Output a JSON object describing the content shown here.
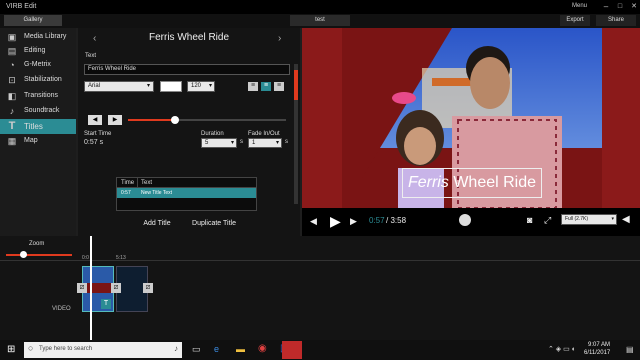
{
  "window": {
    "title": "VIRB Edit",
    "menu": "Menu",
    "min": "–",
    "max": "□",
    "close": "✕"
  },
  "toolbar": {
    "gallery": "Gallery",
    "project_tab": "test",
    "export": "Export",
    "share": "Share"
  },
  "sidebar": {
    "items": [
      {
        "label": "Media Library",
        "icon": "media-icon"
      },
      {
        "label": "Editing",
        "icon": "editing-icon"
      },
      {
        "label": "G-Metrix",
        "icon": "gmetrix-icon"
      },
      {
        "label": "Stabilization",
        "icon": "stabilization-icon"
      },
      {
        "label": "Transitions",
        "icon": "transitions-icon"
      },
      {
        "label": "Soundtrack",
        "icon": "soundtrack-icon"
      },
      {
        "label": "Titles",
        "icon": "titles-icon"
      },
      {
        "label": "Map",
        "icon": "map-icon"
      }
    ]
  },
  "panel": {
    "title": "Ferris Wheel Ride",
    "text_label": "Text",
    "text_value": "Ferris Wheel Ride",
    "font": "Arial",
    "font_size": "120",
    "start_time_label": "Start Time",
    "start_time_value": "0:57",
    "start_time_unit": "s",
    "duration_label": "Duration",
    "duration_value": "5",
    "duration_unit": "s",
    "fade_label": "Fade In/Out",
    "fade_value": "1",
    "fade_unit": "s",
    "table": {
      "headers": [
        "Time",
        "Text"
      ],
      "rows": [
        [
          "0:57",
          "New Title Text"
        ]
      ]
    },
    "add_title": "Add Title",
    "duplicate_title": "Duplicate Title",
    "slider_fraction": 0.3
  },
  "preview": {
    "overlay_italic": "Ferris",
    "overlay_rest": "Wheel Ride",
    "current_time": "0:57",
    "total_time": "3:58",
    "quality": "Full (2.7K)"
  },
  "timeline": {
    "zoom_label": "Zoom",
    "marker1": "0:0",
    "marker2": "5:13",
    "track_label": "VIDEO",
    "clip_badge": "T"
  },
  "taskbar": {
    "search_placeholder": "Type here to search",
    "time": "9:07 AM",
    "date": "6/11/2017"
  }
}
